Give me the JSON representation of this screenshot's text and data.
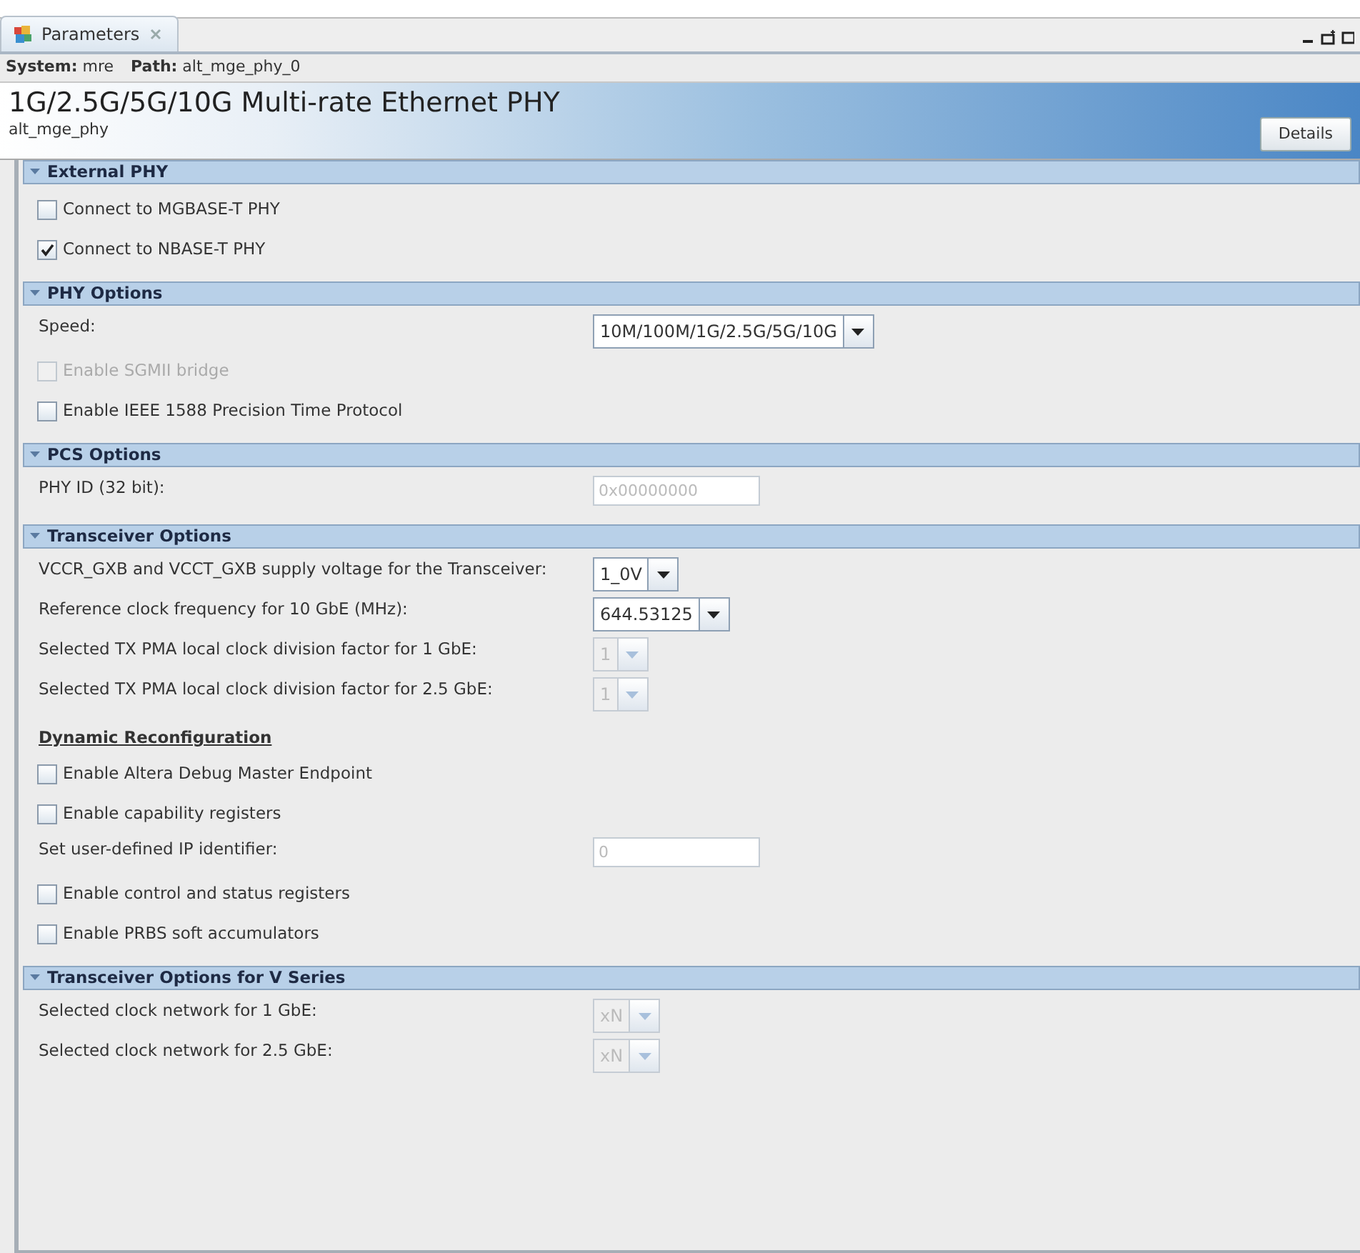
{
  "tab": {
    "label": "Parameters",
    "selected": true
  },
  "path_bar": {
    "system": "**System:** mre",
    "path": "**Path:** alt_mge_phy_0"
  },
  "header": {
    "title": "1G/2.5G/5G/10G Multi-rate Ethernet PHY",
    "subtitle": "alt_mge_phy",
    "button": "Details"
  },
  "sections": [
    {
      "title": "External PHY",
      "expanded": true,
      "rows": [
        {
          "kind": "checkbox",
          "label": "Connect to MGBASE-T PHY",
          "checked": false,
          "disabled": false
        },
        {
          "kind": "checkbox",
          "label": "Connect to NBASE-T PHY",
          "checked": true,
          "disabled": false
        }
      ]
    },
    {
      "title": "PHY Options",
      "expanded": true,
      "rows": [
        {
          "kind": "combo",
          "label": "Speed:",
          "value": "10M/100M/1G/2.5G/5G/10G",
          "disabled": false
        },
        {
          "kind": "checkbox",
          "label": "Enable SGMII bridge",
          "checked": false,
          "disabled": true
        },
        {
          "kind": "checkbox",
          "label": "Enable IEEE 1588 Precision Time Protocol",
          "checked": false,
          "disabled": false
        }
      ]
    },
    {
      "title": "PCS Options",
      "expanded": true,
      "rows": [
        {
          "kind": "text",
          "label": "PHY ID (32 bit):",
          "value": "0x00000000",
          "disabled": true
        }
      ]
    },
    {
      "title": "Transceiver Options",
      "expanded": true,
      "rows": [
        {
          "kind": "combo",
          "label": "VCCR_GXB and VCCT_GXB supply voltage for the Transceiver:",
          "value": "1_0V",
          "disabled": false
        },
        {
          "kind": "combo",
          "label": "Reference clock frequency for 10 GbE (MHz):",
          "value": "644.53125",
          "disabled": false
        },
        {
          "kind": "combo",
          "label": "Selected TX PMA local clock division factor for 1 GbE:",
          "value": "1",
          "disabled": true
        },
        {
          "kind": "combo",
          "label": "Selected TX PMA local clock division factor for 2.5 GbE:",
          "value": "1",
          "disabled": true
        },
        {
          "kind": "heading",
          "label": "Dynamic Reconfiguration"
        },
        {
          "kind": "checkbox",
          "label": "Enable Altera Debug Master Endpoint",
          "checked": false,
          "disabled": false
        },
        {
          "kind": "checkbox",
          "label": "Enable capability registers",
          "checked": false,
          "disabled": false
        },
        {
          "kind": "text",
          "label": "Set user-defined IP identifier:",
          "value": "0",
          "disabled": true
        },
        {
          "kind": "checkbox",
          "label": "Enable control and status registers",
          "checked": false,
          "disabled": false
        },
        {
          "kind": "checkbox",
          "label": "Enable PRBS soft accumulators",
          "checked": false,
          "disabled": false
        }
      ]
    },
    {
      "title": "Transceiver Options for V Series",
      "expanded": true,
      "rows": [
        {
          "kind": "combo",
          "label": "Selected clock network for 1 GbE:",
          "value": "xN",
          "disabled": true
        },
        {
          "kind": "combo",
          "label": "Selected clock network for 2.5 GbE:",
          "value": "xN",
          "disabled": true
        }
      ]
    }
  ]
}
